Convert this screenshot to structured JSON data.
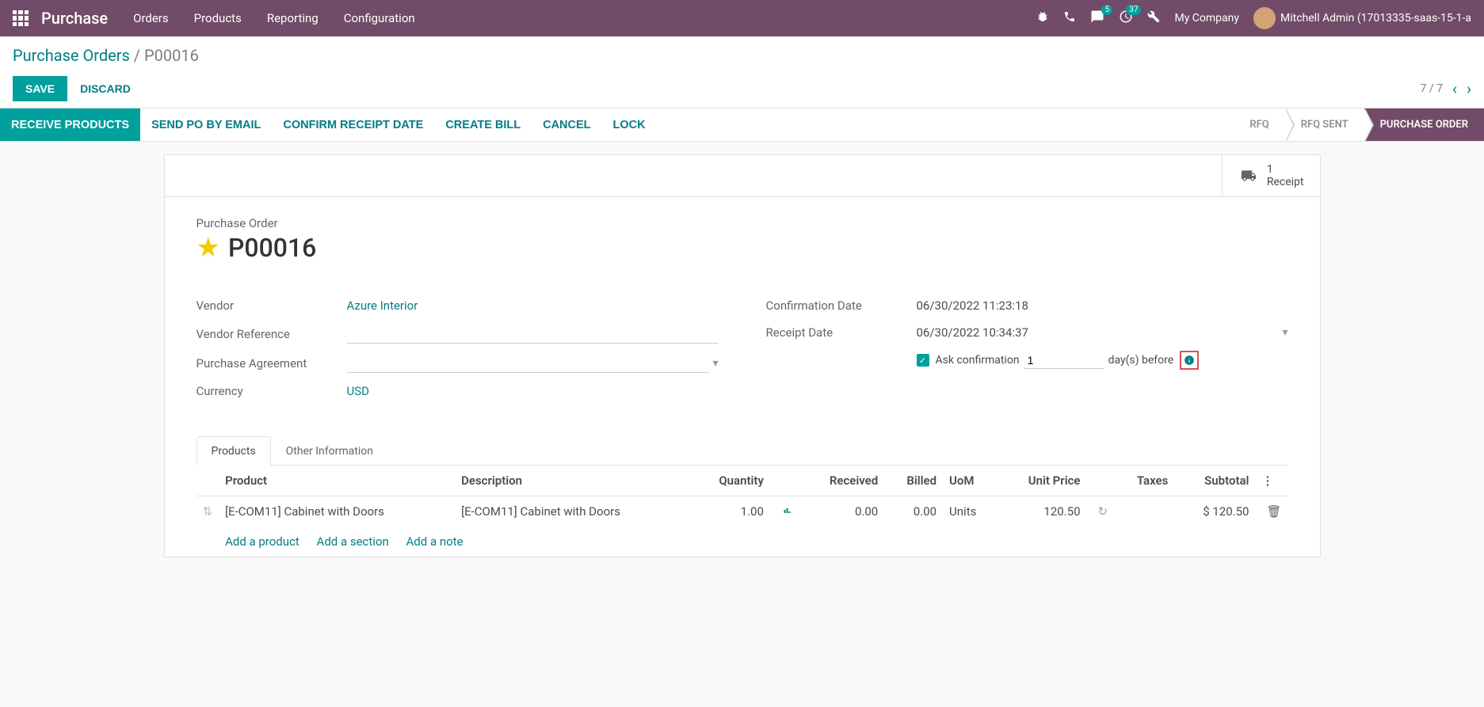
{
  "nav": {
    "brand": "Purchase",
    "menu": [
      "Orders",
      "Products",
      "Reporting",
      "Configuration"
    ],
    "chat_badge": "5",
    "activity_badge": "37",
    "company": "My Company",
    "user": "Mitchell Admin (17013335-saas-15-1-a"
  },
  "breadcrumb": {
    "parent": "Purchase Orders",
    "current": "P00016"
  },
  "buttons": {
    "save": "SAVE",
    "discard": "DISCARD"
  },
  "pager": {
    "text": "7 / 7"
  },
  "actions": [
    "RECEIVE PRODUCTS",
    "SEND PO BY EMAIL",
    "CONFIRM RECEIPT DATE",
    "CREATE BILL",
    "CANCEL",
    "LOCK"
  ],
  "status": [
    "RFQ",
    "RFQ SENT",
    "PURCHASE ORDER"
  ],
  "stat_button": {
    "count": "1",
    "label": "Receipt"
  },
  "title": {
    "label": "Purchase Order",
    "value": "P00016"
  },
  "fields_left": {
    "vendor_label": "Vendor",
    "vendor_value": "Azure Interior",
    "vendor_ref_label": "Vendor Reference",
    "agreement_label": "Purchase Agreement",
    "currency_label": "Currency",
    "currency_value": "USD"
  },
  "fields_right": {
    "confirm_label": "Confirmation Date",
    "confirm_value": "06/30/2022 11:23:18",
    "receipt_label": "Receipt Date",
    "receipt_value": "06/30/2022 10:34:37",
    "ask_conf_label": "Ask confirmation",
    "days_value": "1",
    "days_suffix": "day(s) before"
  },
  "tabs": [
    "Products",
    "Other Information"
  ],
  "table": {
    "headers": {
      "product": "Product",
      "description": "Description",
      "quantity": "Quantity",
      "received": "Received",
      "billed": "Billed",
      "uom": "UoM",
      "unit_price": "Unit Price",
      "taxes": "Taxes",
      "subtotal": "Subtotal"
    },
    "row": {
      "product": "[E-COM11] Cabinet with Doors",
      "description": "[E-COM11] Cabinet with Doors",
      "quantity": "1.00",
      "received": "0.00",
      "billed": "0.00",
      "uom": "Units",
      "unit_price": "120.50",
      "subtotal": "$ 120.50"
    },
    "add": {
      "product": "Add a product",
      "section": "Add a section",
      "note": "Add a note"
    }
  }
}
